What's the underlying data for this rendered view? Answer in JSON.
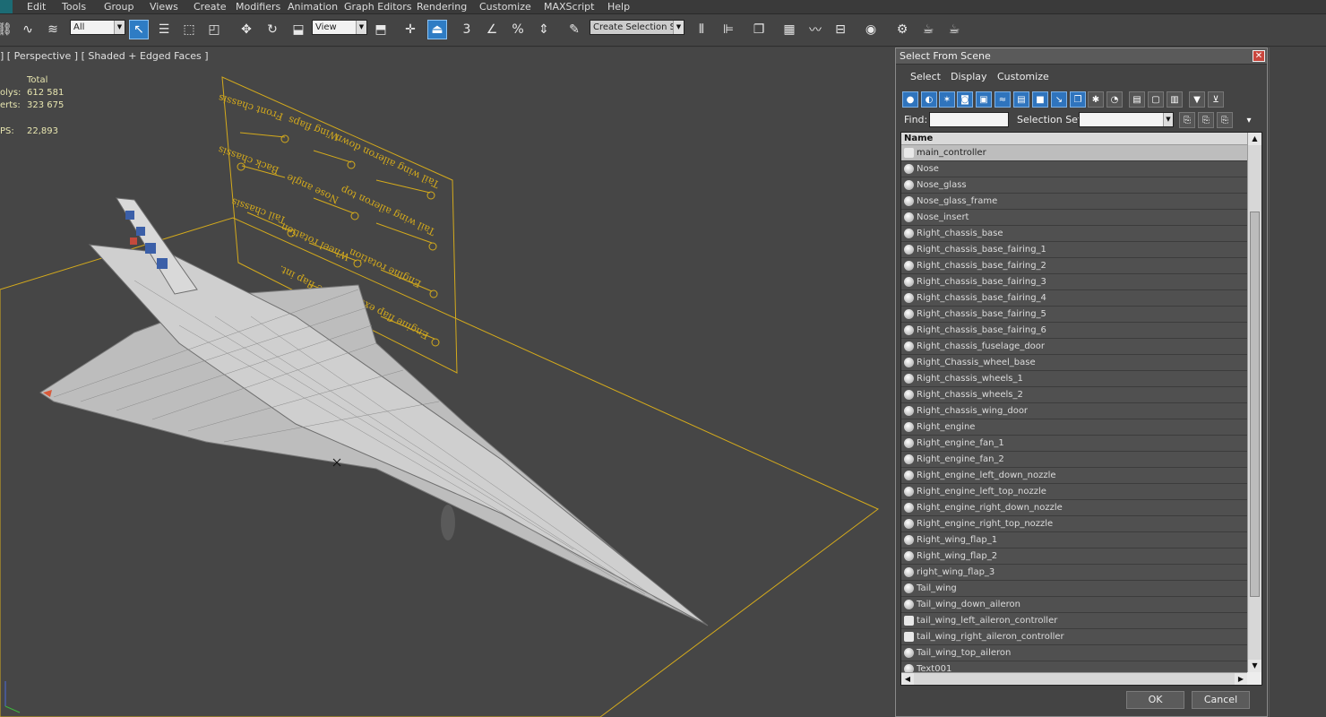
{
  "menubar": {
    "items": [
      "Edit",
      "Tools",
      "Group",
      "Views",
      "Create",
      "Modifiers",
      "Animation",
      "Graph Editors",
      "Rendering",
      "Customize",
      "MAXScript",
      "Help"
    ]
  },
  "toolbar": {
    "filter_select": "All",
    "ref_coord_select": "View",
    "named_selection_placeholder": "Create Selection Se"
  },
  "viewport": {
    "label": "] [ Perspective ] [ Shaded + Edged Faces ]",
    "stats": {
      "total_label": "Total",
      "polys_label": "olys:",
      "polys_value": "612 581",
      "verts_label": "erts:",
      "verts_value": "323 675",
      "fps_label": "PS:",
      "fps_value": "22,893"
    },
    "panel_labels": [
      "Front chassis",
      "Wing flaps",
      "Tail wing aileron down",
      "Back chassis",
      "Nose angle",
      "Tail wing aileron top",
      "Tail chassis",
      "Wheel rotation",
      "Engine rotation",
      "Engine flap int.",
      "Engine flap ext."
    ]
  },
  "dialog": {
    "title": "Select From Scene",
    "close": "✕",
    "menus": [
      "Select",
      "Display",
      "Customize"
    ],
    "find_label": "Find:",
    "find_value": "",
    "selection_set_label": "Selection Set:",
    "list_header": "Name",
    "items": [
      {
        "name": "main_controller",
        "selected": true,
        "helper": true
      },
      {
        "name": "Nose"
      },
      {
        "name": "Nose_glass"
      },
      {
        "name": "Nose_glass_frame"
      },
      {
        "name": "Nose_insert"
      },
      {
        "name": "Right_chassis_base"
      },
      {
        "name": "Right_chassis_base_fairing_1"
      },
      {
        "name": "Right_chassis_base_fairing_2"
      },
      {
        "name": "Right_chassis_base_fairing_3"
      },
      {
        "name": "Right_chassis_base_fairing_4"
      },
      {
        "name": "Right_chassis_base_fairing_5"
      },
      {
        "name": "Right_chassis_base_fairing_6"
      },
      {
        "name": "Right_chassis_fuselage_door"
      },
      {
        "name": "Right_Chassis_wheel_base"
      },
      {
        "name": "Right_chassis_wheels_1"
      },
      {
        "name": "Right_chassis_wheels_2"
      },
      {
        "name": "Right_chassis_wing_door"
      },
      {
        "name": "Right_engine"
      },
      {
        "name": "Right_engine_fan_1"
      },
      {
        "name": "Right_engine_fan_2"
      },
      {
        "name": "Right_engine_left_down_nozzle"
      },
      {
        "name": "Right_engine_left_top_nozzle"
      },
      {
        "name": "Right_engine_right_down_nozzle"
      },
      {
        "name": "Right_engine_right_top_nozzle"
      },
      {
        "name": "Right_wing_flap_1"
      },
      {
        "name": "Right_wing_flap_2"
      },
      {
        "name": "right_wing_flap_3"
      },
      {
        "name": "Tail_wing"
      },
      {
        "name": "Tail_wing_down_aileron"
      },
      {
        "name": "tail_wing_left_aileron_controller",
        "helper": true
      },
      {
        "name": "tail_wing_right_aileron_controller",
        "helper": true
      },
      {
        "name": "Tail_wing_top_aileron"
      },
      {
        "name": "Text001"
      }
    ],
    "ok_label": "OK",
    "cancel_label": "Cancel"
  }
}
